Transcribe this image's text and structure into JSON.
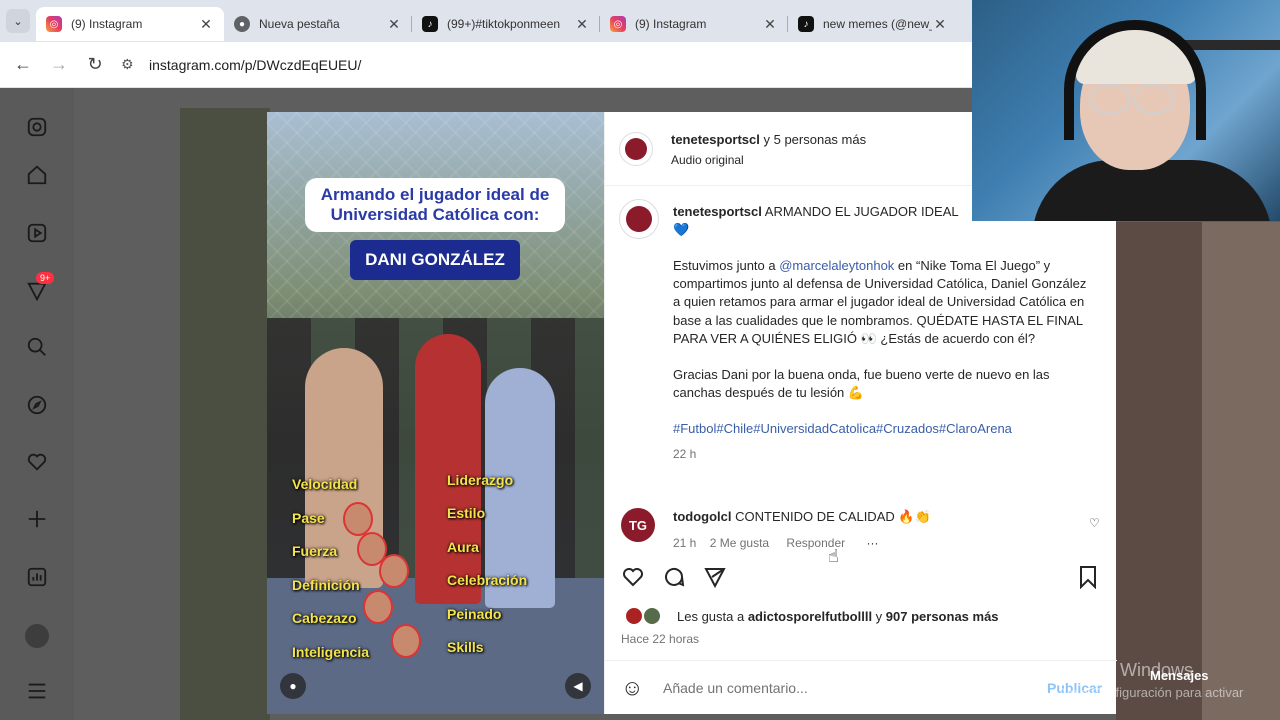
{
  "browser": {
    "tabs": [
      {
        "title": "(9) Instagram",
        "favicon": "instagram",
        "active": true
      },
      {
        "title": "Nueva pestaña",
        "favicon": "chrome",
        "active": false
      },
      {
        "title": "(99+)#tiktokponmeen",
        "favicon": "tiktok",
        "active": false
      },
      {
        "title": "(9) Instagram",
        "favicon": "instagram",
        "active": false
      },
      {
        "title": "new memes (@new_",
        "favicon": "tiktok",
        "active": false
      }
    ],
    "close_glyph": "✕",
    "url": "instagram.com/p/DWczdEqEUEU/"
  },
  "sidebar": {
    "badge": "9+"
  },
  "media": {
    "headline": "Armando el jugador ideal de Universidad Católica con:",
    "name": "DANI GONZÁLEZ",
    "traits_left": [
      "Velocidad",
      "Pase",
      "Fuerza",
      "Definición",
      "Cabezazo",
      "Inteligencia"
    ],
    "traits_right": [
      "Liderazgo",
      "Estilo",
      "Aura",
      "Celebración",
      "Peinado",
      "Skills"
    ]
  },
  "post": {
    "author": "tenetesportscl",
    "coauthors": "y 5 personas más",
    "audio": "Audio original",
    "caption_author": "tenetesportscl",
    "caption_head": "ARMANDO EL JUGADOR IDEAL",
    "caption_emoji": "💙",
    "caption_p1_a": "Estuvimos junto a ",
    "caption_mention": "@marcelaleytonhok",
    "caption_p1_b": " en “Nike Toma El Juego” y compartimos junto al defensa de Universidad Católica, Daniel González a quien retamos para armar el jugador ideal de Universidad Católica en base a las cualidades que le nombramos. QUÉDATE HASTA EL FINAL PARA VER A QUIÉNES ELIGIÓ 👀 ¿Estás de acuerdo con él?",
    "caption_p2": "Gracias Dani por la buena onda, fue bueno verte de nuevo en las canchas después de tu lesión 💪",
    "hashtags": "#Futbol#Chile#UniversidadCatolica#Cruzados#ClaroArena",
    "caption_time": "22 h",
    "comment": {
      "author": "todogolcl",
      "text": "CONTENIDO DE CALIDAD 🔥👏",
      "time": "21 h",
      "likes": "2 Me gusta",
      "reply": "Responder",
      "more": "···"
    },
    "likes_prefix": "Les gusta a ",
    "likes_user": "adictosporelfutbollll",
    "likes_mid": " y ",
    "likes_count": "907 personas más",
    "posted": "Hace 22 horas",
    "comment_placeholder": "Añade un comentario...",
    "publish": "Publicar"
  },
  "overlay": {
    "activate_title": "Activar Windows",
    "activate_sub": "Ve a Configuración para activar",
    "messages": "Mensajes"
  },
  "colors": {
    "accent": "#0095f6",
    "hashtag": "#3a5da9",
    "badge": "#ff3040"
  }
}
